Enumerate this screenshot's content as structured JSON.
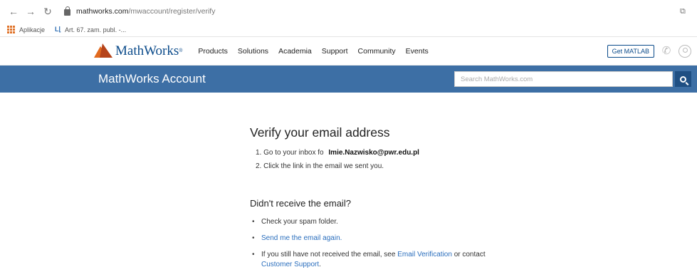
{
  "browser": {
    "url_host": "mathworks.com",
    "url_path": "/mwaccount/register/verify"
  },
  "bookmarks": {
    "apps_label": "Aplikacje",
    "item1_label": "Art. 67. zam. publ. -..."
  },
  "header": {
    "logo_text": "MathWorks",
    "nav": [
      "Products",
      "Solutions",
      "Academia",
      "Support",
      "Community",
      "Events"
    ],
    "get_matlab_label": "Get MATLAB"
  },
  "band": {
    "title": "MathWorks Account",
    "search_placeholder": "Search MathWorks.com"
  },
  "verify": {
    "heading": "Verify your email address",
    "step1_prefix": "1. Go to your inbox fo",
    "email": "Imie.Nazwisko@pwr.edu.pl",
    "step2": "2. Click the link in the email we sent you."
  },
  "help": {
    "heading": "Didn't receive the email?",
    "tip1": "Check your spam folder.",
    "tip2_link": "Send me the email again.",
    "tip3_prefix": "If you still have not received the email, see",
    "tip3_link1": "Email Verification",
    "tip3_middle": "or contact",
    "tip3_link2": "Customer Support",
    "tip3_suffix": "."
  }
}
